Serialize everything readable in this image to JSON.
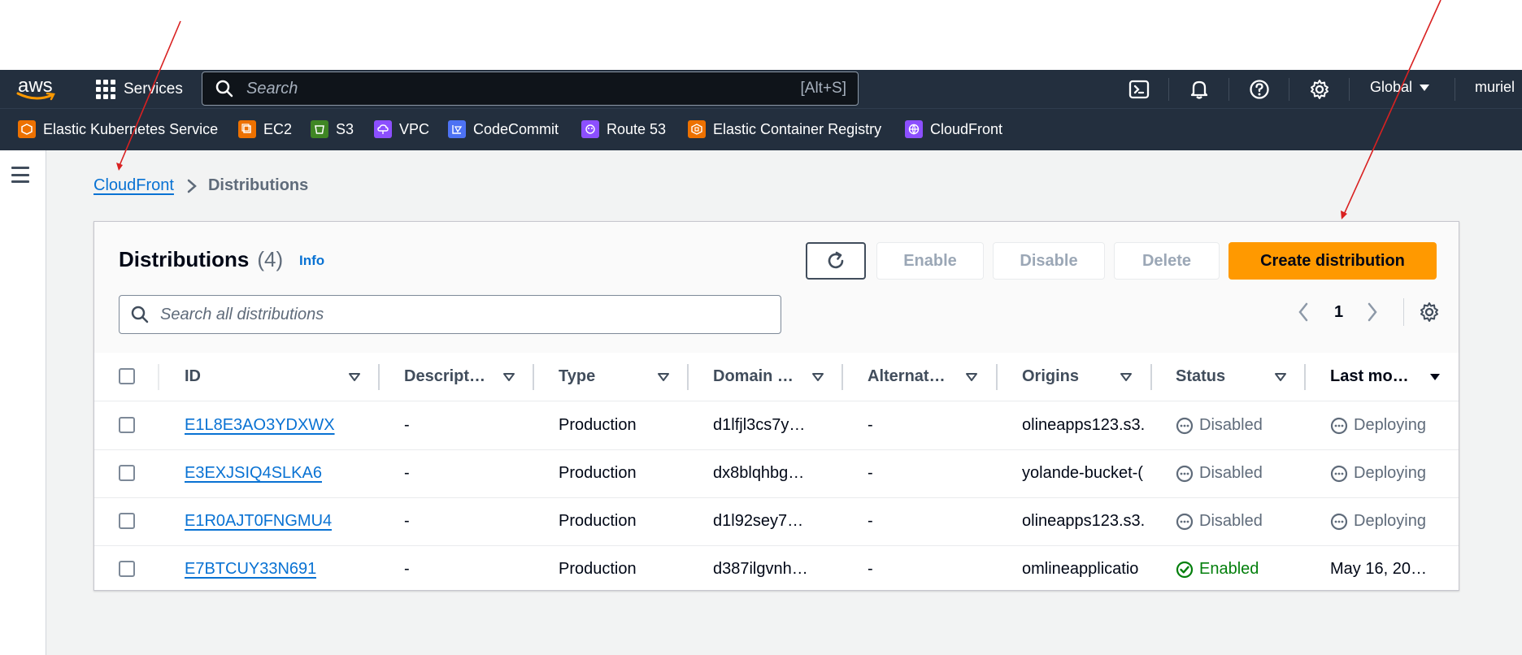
{
  "topnav": {
    "logo_text": "aws",
    "services_label": "Services",
    "search_placeholder": "Search",
    "search_shortcut": "[Alt+S]",
    "region_label": "Global",
    "user_label": "muriel"
  },
  "favorites": [
    {
      "label": "Elastic Kubernetes Service",
      "icon": "eks-icon",
      "color": "#ed7100"
    },
    {
      "label": "EC2",
      "icon": "ec2-icon",
      "color": "#ed7100"
    },
    {
      "label": "S3",
      "icon": "s3-icon",
      "color": "#3f8624"
    },
    {
      "label": "VPC",
      "icon": "vpc-icon",
      "color": "#8c4fff"
    },
    {
      "label": "CodeCommit",
      "icon": "codecommit-icon",
      "color": "#4d72f3"
    },
    {
      "label": "Route 53",
      "icon": "route53-icon",
      "color": "#8c4fff"
    },
    {
      "label": "Elastic Container Registry",
      "icon": "ecr-icon",
      "color": "#ed7100"
    },
    {
      "label": "CloudFront",
      "icon": "cloudfront-icon",
      "color": "#8c4fff"
    }
  ],
  "breadcrumb": {
    "root": "CloudFront",
    "current": "Distributions"
  },
  "panel": {
    "title": "Distributions",
    "count": "(4)",
    "info_label": "Info",
    "buttons": {
      "enable": "Enable",
      "disable": "Disable",
      "delete": "Delete",
      "create": "Create distribution"
    },
    "search_placeholder": "Search all distributions",
    "page_number": "1"
  },
  "table": {
    "columns": [
      "ID",
      "Descript…",
      "Type",
      "Domain …",
      "Alternat…",
      "Origins",
      "Status",
      "Last mo…"
    ],
    "rows": [
      {
        "id": "E1L8E3AO3YDXWX",
        "description": "-",
        "type": "Production",
        "domain": "d1lfjl3cs7y…",
        "alternate": "-",
        "origins": "olineapps123.s3.",
        "status": "Disabled",
        "last_modified": "Deploying"
      },
      {
        "id": "E3EXJSIQ4SLKA6",
        "description": "-",
        "type": "Production",
        "domain": "dx8blqhbg…",
        "alternate": "-",
        "origins": "yolande-bucket-(",
        "status": "Disabled",
        "last_modified": "Deploying"
      },
      {
        "id": "E1R0AJT0FNGMU4",
        "description": "-",
        "type": "Production",
        "domain": "d1l92sey7…",
        "alternate": "-",
        "origins": "olineapps123.s3.",
        "status": "Disabled",
        "last_modified": "Deploying"
      },
      {
        "id": "E7BTCUY33N691",
        "description": "-",
        "type": "Production",
        "domain": "d387ilgvnh…",
        "alternate": "-",
        "origins": "omlineapplicatio",
        "status": "Enabled",
        "last_modified": "May 16, 20…"
      }
    ]
  },
  "colors": {
    "nav_bg": "#232f3e",
    "link": "#0972d3",
    "primary_button": "#ff9900",
    "status_enabled": "#037f0c",
    "annotation_arrow": "#d92121"
  }
}
